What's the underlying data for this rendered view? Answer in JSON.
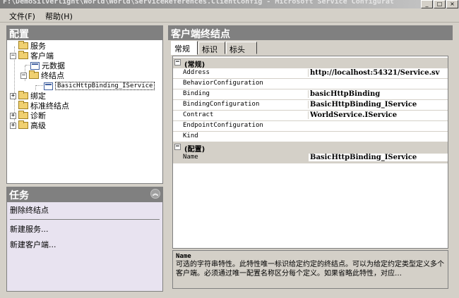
{
  "window": {
    "title": "F:\\DemoSilverlight\\World\\World\\ServiceReferences.ClientConfig - Microsoft Service Configurat"
  },
  "menu": [
    {
      "label": "文件(F)"
    },
    {
      "label": "帮助(H)"
    }
  ],
  "config_panel": {
    "title": "配置",
    "tree": [
      {
        "label": "服务"
      },
      {
        "label": "客户端"
      },
      {
        "label": "元数据"
      },
      {
        "label": "终结点"
      },
      {
        "label": "BasicHttpBinding_IService"
      },
      {
        "label": "绑定"
      },
      {
        "label": "标准终结点"
      },
      {
        "label": "诊断"
      },
      {
        "label": "高级"
      }
    ]
  },
  "tasks_panel": {
    "title": "任务",
    "items": [
      {
        "label": "删除终结点"
      },
      {
        "label": "新建服务..."
      },
      {
        "label": "新建客户端..."
      }
    ]
  },
  "endpoint_panel": {
    "title": "客户端终结点",
    "tabs": [
      {
        "label": "常规"
      },
      {
        "label": "标识"
      },
      {
        "label": "标头"
      }
    ],
    "categories": [
      {
        "label": "(常规)",
        "properties": [
          {
            "name": "Address",
            "value": "http://localhost:54321/Service.sv"
          },
          {
            "name": "BehaviorConfiguration",
            "value": ""
          },
          {
            "name": "Binding",
            "value": "basicHttpBinding"
          },
          {
            "name": "BindingConfiguration",
            "value": "BasicHttpBinding_IService"
          },
          {
            "name": "Contract",
            "value": "WorldService.IService"
          },
          {
            "name": "EndpointConfiguration",
            "value": ""
          },
          {
            "name": "Kind",
            "value": ""
          }
        ]
      },
      {
        "label": "(配置)",
        "properties": [
          {
            "name": "Name",
            "value": "BasicHttpBinding_IService"
          }
        ]
      }
    ],
    "description": {
      "title": "Name",
      "text": "可选的字符串特性。此特性唯一标识给定约定的终结点。可以为给定约定类型定义多个客户端。必须通过唯一配置名称区分每个定义。如果省略此特性，对应…"
    }
  }
}
